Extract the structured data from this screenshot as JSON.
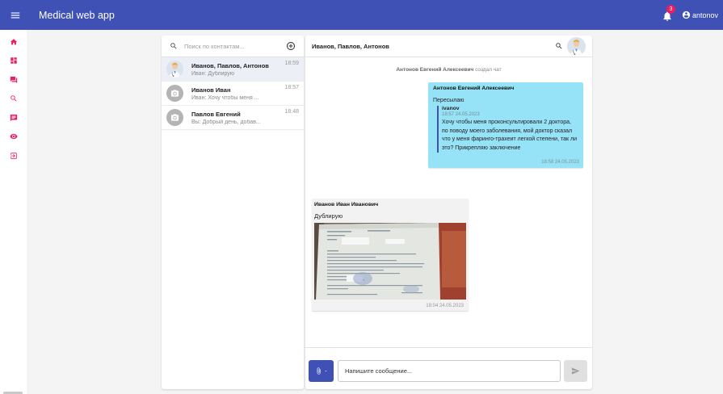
{
  "app": {
    "title": "Medical web app"
  },
  "header": {
    "notifications_count": "3",
    "username": "antonov"
  },
  "nav": {
    "icons": [
      "home-icon",
      "dashboard-icon",
      "forum-icon",
      "search-icon",
      "chat-icon",
      "visibility-icon",
      "logout-icon"
    ],
    "accent_color": "#e91e63"
  },
  "contacts": {
    "search_placeholder": "Поиск по контактам...",
    "items": [
      {
        "name": "Иванов, Павлов, Антонов",
        "last": "Иван: Дублирую",
        "time": "18:59",
        "active": true
      },
      {
        "name": "Иванов Иван",
        "last": "Иван: Хочу чтобы меня ...",
        "time": "18:57"
      },
      {
        "name": "Павлов Евгений",
        "last": "Вы: Добрый день, добав...",
        "time": "18:48"
      }
    ]
  },
  "chat": {
    "title": "Иванов, Павлов, Антонов",
    "system_message": {
      "actor": "Антонов Евгений Алексеевич",
      "action": "создал чат"
    },
    "outgoing": {
      "sender": "Антонов Евгений Алексеевич",
      "forward_label": "Пересылаю",
      "quote": {
        "author": "ivanov",
        "meta": "18:57   24.05.2023",
        "text": "Хочу чтобы меня проконсультировали 2 доктора, по поводу моего заболевания, мой доктор сказал что у меня фаринго-трахеит легкой степени, так ли это? Прикрепляю заключение"
      },
      "time": "18:58   24.05.2023"
    },
    "incoming": {
      "sender": "Иванов Иван Иванович",
      "text": "Дублирую",
      "time": "18:04   24.05.2023"
    },
    "composer": {
      "placeholder": "Напишите сообщение..."
    }
  },
  "colors": {
    "primary": "#3f51b5",
    "outgoing_bubble": "#96e2f7",
    "incoming_bubble": "#f2f2f2",
    "accent": "#e91e63"
  }
}
